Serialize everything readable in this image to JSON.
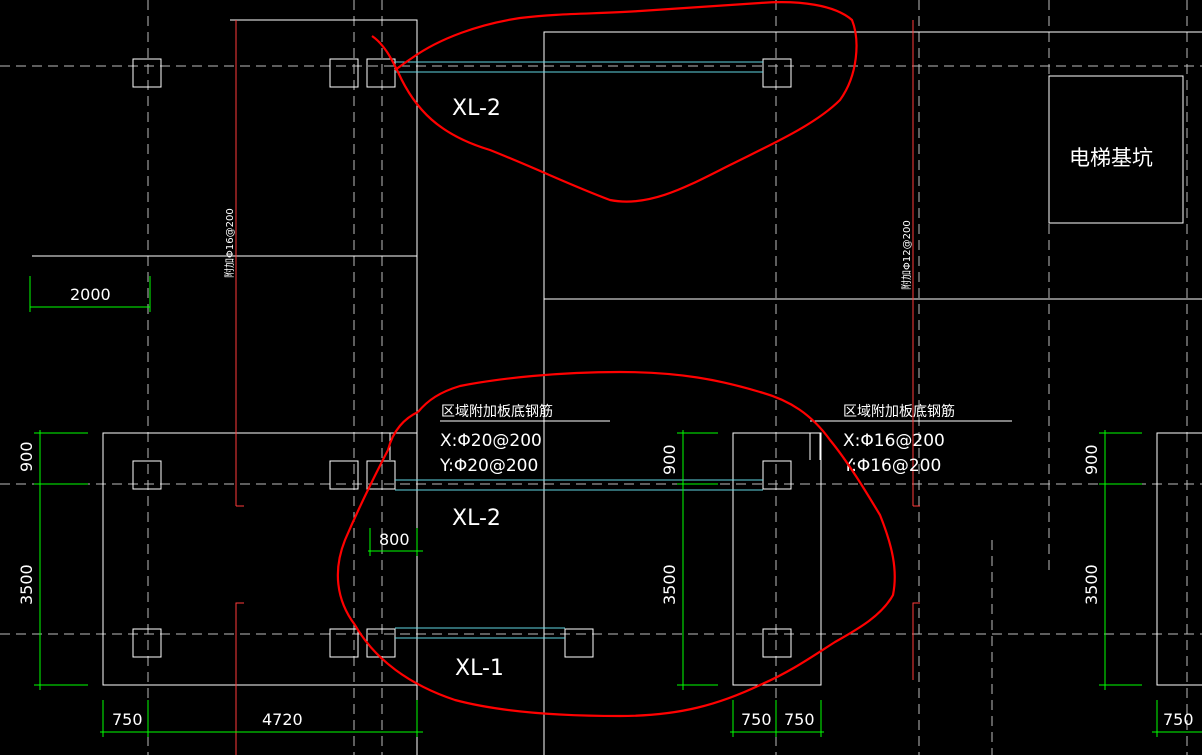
{
  "colors": {
    "background": "#000000",
    "outline": "#ffffff",
    "center_line": "#bdbdbd",
    "beam": "#5fd3e0",
    "dimension": "#00ff00",
    "annotation_mark": "#ff3a3a",
    "markup": "#ff0000",
    "text": "#ffffff"
  },
  "beams": {
    "top": "XL-2",
    "middle": "XL-2",
    "bottom": "XL-1"
  },
  "elevator_pit": "电梯基坑",
  "rebar_notes": {
    "left": {
      "title": "区域附加板底钢筋",
      "x": "X:Φ20@200",
      "y": "Y:Φ20@200"
    },
    "right": {
      "title": "区域附加板底钢筋",
      "x": "X:Φ16@200",
      "y": "Y:Φ16@200"
    }
  },
  "vertical_notes": {
    "left": "附加Φ16@200",
    "right": "附加Φ12@200"
  },
  "dimensions": {
    "top_left": "2000",
    "left_900": "900",
    "left_3500": "3500",
    "bottom_750": "750",
    "bottom_4720": "4720",
    "mid_800": "800",
    "mid_900": "900",
    "mid_3500": "3500",
    "bottom_750_a": "750",
    "bottom_750_b": "750",
    "right_900": "900",
    "right_3500": "3500",
    "right_750": "750"
  }
}
